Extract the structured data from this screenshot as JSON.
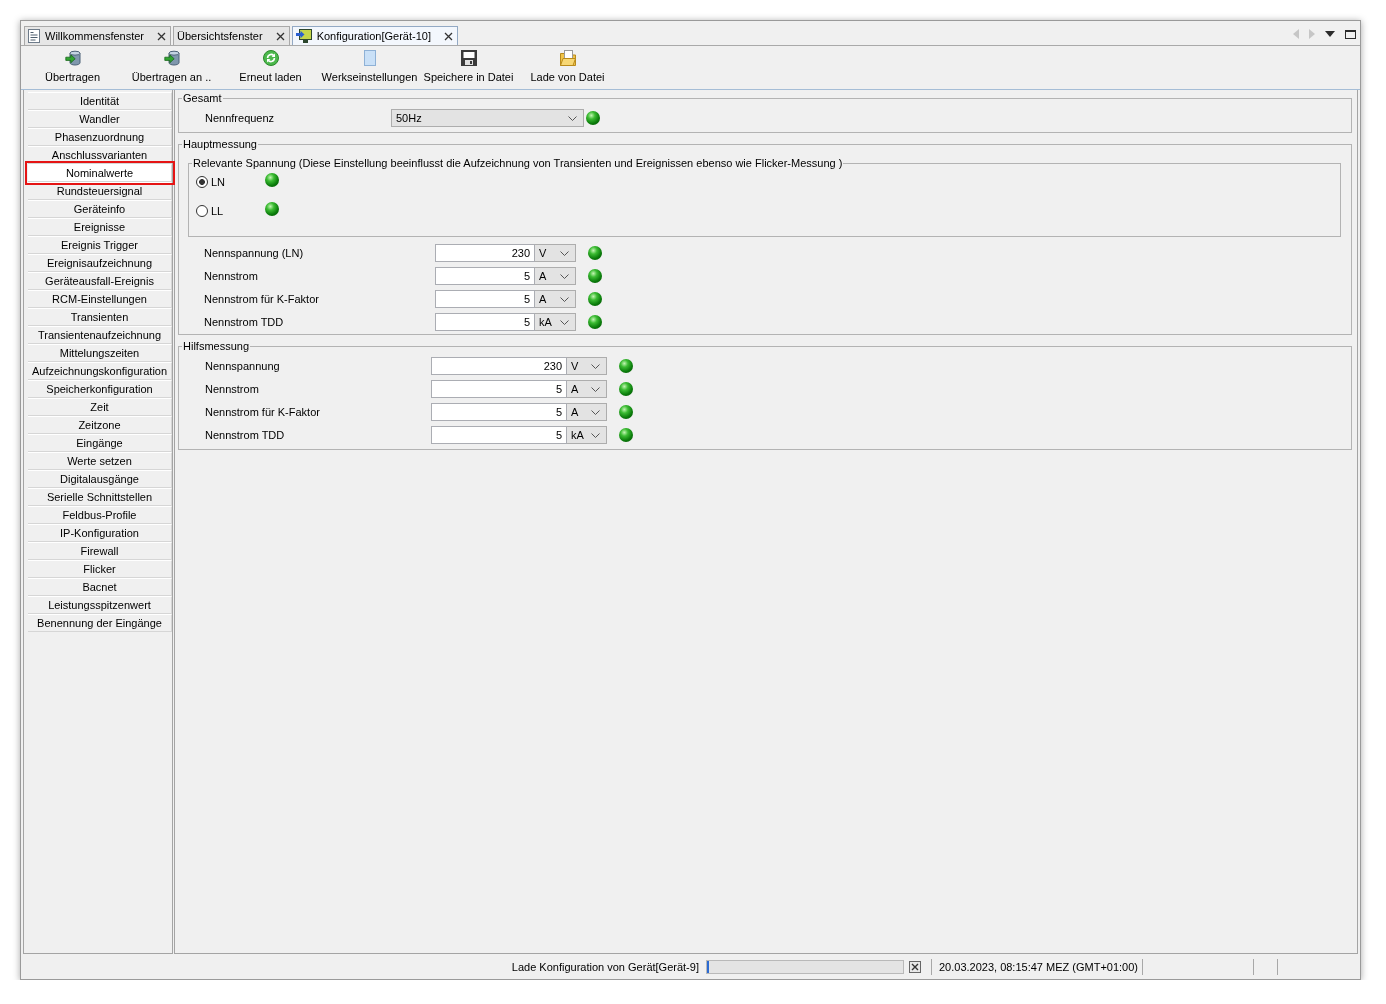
{
  "tabs": [
    {
      "label": "Willkommensfenster",
      "kind": "document",
      "selected": false
    },
    {
      "label": "Übersichtsfenster",
      "kind": "plain",
      "selected": false
    },
    {
      "label": "Konfiguration[Gerät-10]",
      "kind": "device",
      "selected": true
    }
  ],
  "tab_navigation": [
    {
      "kind": "previous",
      "disabled": true
    },
    {
      "kind": "next",
      "disabled": true
    },
    {
      "kind": "menu",
      "disabled": false
    },
    {
      "kind": "maximize",
      "disabled": false
    }
  ],
  "toolbar": [
    {
      "label": "Übertragen",
      "kind": "transfer"
    },
    {
      "label": "Übertragen an ..",
      "kind": "transfer"
    },
    {
      "label": "Erneut laden",
      "kind": "reload"
    },
    {
      "label": "Werkseinstellungen",
      "kind": "defaults"
    },
    {
      "label": "Speichere in Datei",
      "kind": "save"
    },
    {
      "label": "Lade von Datei",
      "kind": "load"
    }
  ],
  "sidebar": {
    "items": [
      {
        "label": "Identität",
        "selected": false
      },
      {
        "label": "Wandler",
        "selected": false
      },
      {
        "label": "Phasenzuordnung",
        "selected": false
      },
      {
        "label": "Anschlussvarianten",
        "selected": false
      },
      {
        "label": "Nominalwerte",
        "selected": true
      },
      {
        "label": "Rundsteuersignal",
        "selected": false
      },
      {
        "label": "Geräteinfo",
        "selected": false
      },
      {
        "label": "Ereignisse",
        "selected": false
      },
      {
        "label": "Ereignis Trigger",
        "selected": false
      },
      {
        "label": "Ereignisaufzeichnung",
        "selected": false
      },
      {
        "label": "Geräteausfall-Ereignis",
        "selected": false
      },
      {
        "label": "RCM-Einstellungen",
        "selected": false
      },
      {
        "label": "Transienten",
        "selected": false
      },
      {
        "label": "Transientenaufzeichnung",
        "selected": false
      },
      {
        "label": "Mittelungszeiten",
        "selected": false
      },
      {
        "label": "Aufzeichnungskonfiguration",
        "selected": false
      },
      {
        "label": "Speicherkonfiguration",
        "selected": false
      },
      {
        "label": "Zeit",
        "selected": false
      },
      {
        "label": "Zeitzone",
        "selected": false
      },
      {
        "label": "Eingänge",
        "selected": false
      },
      {
        "label": "Werte setzen",
        "selected": false
      },
      {
        "label": "Digitalausgänge",
        "selected": false
      },
      {
        "label": "Serielle Schnittstellen",
        "selected": false
      },
      {
        "label": "Feldbus-Profile",
        "selected": false
      },
      {
        "label": "IP-Konfiguration",
        "selected": false
      },
      {
        "label": "Firewall",
        "selected": false
      },
      {
        "label": "Flicker",
        "selected": false
      },
      {
        "label": "Bacnet",
        "selected": false
      },
      {
        "label": "Leistungsspitzenwert",
        "selected": false
      },
      {
        "label": "Benennung der Eingänge",
        "selected": false
      }
    ]
  },
  "sections": [
    {
      "title": "Gesamt",
      "fields": [
        {
          "kind": "select",
          "label": "Nennfrequenz",
          "value": "50Hz",
          "valid": true
        }
      ]
    },
    {
      "title": "Hauptmessung",
      "option_group": {
        "title": "Relevante Spannung (Diese Einstellung beeinflusst die Aufzeichnung von Transienten und Ereignissen ebenso wie Flicker-Messung )",
        "options": [
          {
            "label": "LN",
            "selected": true,
            "valid": true
          },
          {
            "label": "LL",
            "selected": false,
            "valid": true
          }
        ]
      },
      "fields": [
        {
          "kind": "number",
          "label": "Nennspannung (LN)",
          "value": "230",
          "unit": "V",
          "valid": true
        },
        {
          "kind": "number",
          "label": "Nennstrom",
          "value": "5",
          "unit": "A",
          "valid": true
        },
        {
          "kind": "number",
          "label": "Nennstrom für K-Faktor",
          "value": "5",
          "unit": "A",
          "valid": true
        },
        {
          "kind": "number",
          "label": "Nennstrom TDD",
          "value": "5",
          "unit": "kA",
          "valid": true
        }
      ]
    },
    {
      "title": "Hilfsmessung",
      "fields": [
        {
          "kind": "number",
          "label": "Nennspannung",
          "value": "230",
          "unit": "V",
          "valid": true
        },
        {
          "kind": "number",
          "label": "Nennstrom",
          "value": "5",
          "unit": "A",
          "valid": true
        },
        {
          "kind": "number",
          "label": "Nennstrom für K-Faktor",
          "value": "5",
          "unit": "A",
          "valid": true
        },
        {
          "kind": "number",
          "label": "Nennstrom TDD",
          "value": "5",
          "unit": "kA",
          "valid": true
        }
      ]
    }
  ],
  "status_bar": {
    "message": "Lade Konfiguration von Gerät[Gerät-9]",
    "progress": {
      "level": 0.01
    },
    "datetime": "20.03.2023, 08:15:47 MEZ (GMT+01:00)"
  }
}
